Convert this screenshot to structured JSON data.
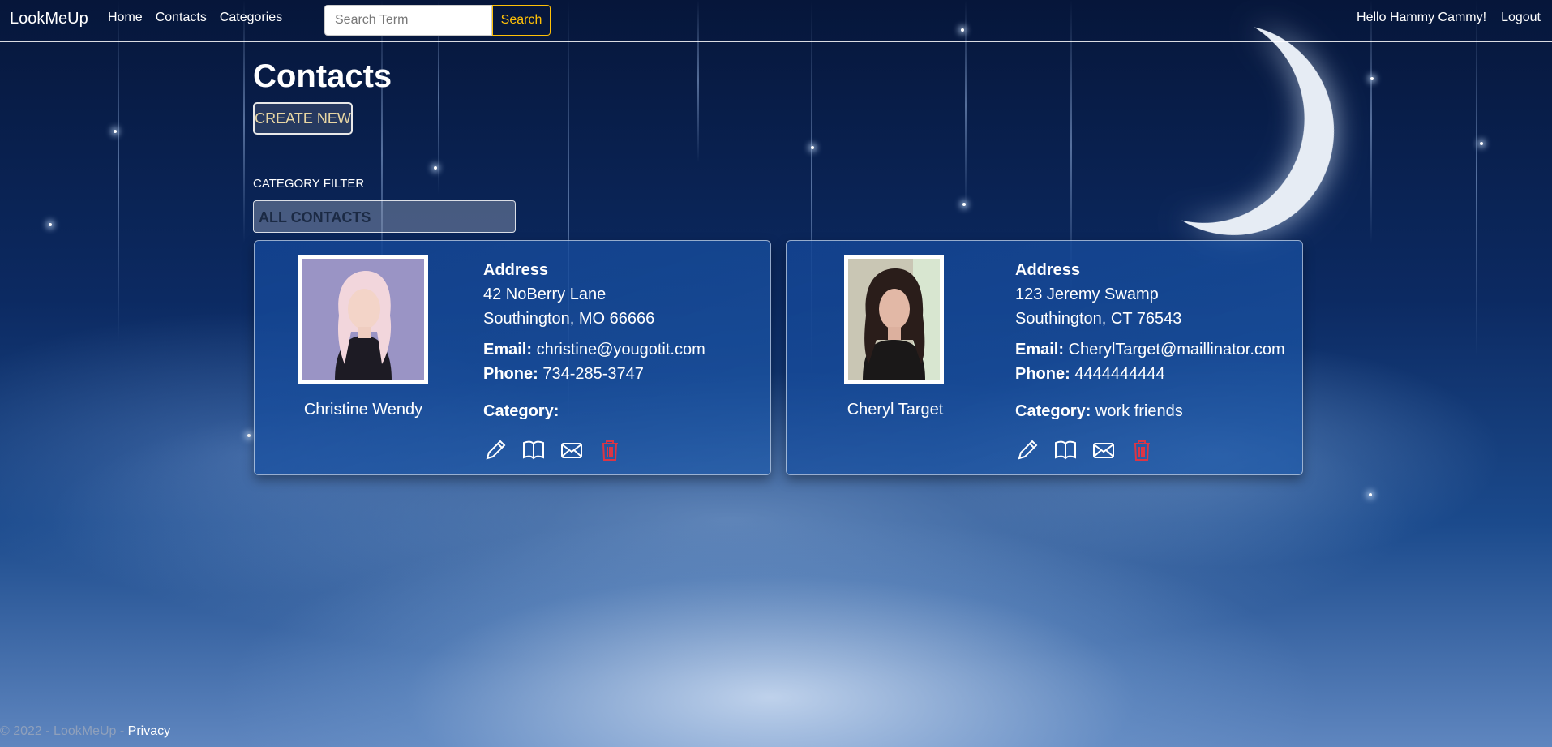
{
  "navbar": {
    "brand": "LookMeUp",
    "links": [
      "Home",
      "Contacts",
      "Categories"
    ],
    "search_placeholder": "Search Term",
    "search_button": "Search",
    "greeting": "Hello Hammy Cammy!",
    "logout": "Logout"
  },
  "main": {
    "title": "Contacts",
    "create_button": "CREATE NEW",
    "filter_label": "CATEGORY FILTER",
    "filter_selected": "ALL CONTACTS"
  },
  "contacts": [
    {
      "name": "Christine Wendy",
      "address_label": "Address",
      "address_line1": "42 NoBerry Lane",
      "address_line2": "Southington, MO 66666",
      "email_label": "Email:",
      "email": "christine@yougotit.com",
      "phone_label": "Phone:",
      "phone": "734-285-3747",
      "category_label": "Category:",
      "category": ""
    },
    {
      "name": "Cheryl Target",
      "address_label": "Address",
      "address_line1": "123 Jeremy Swamp",
      "address_line2": "Southington, CT 76543",
      "email_label": "Email:",
      "email": "CherylTarget@maillinator.com",
      "phone_label": "Phone:",
      "phone": "4444444444",
      "category_label": "Category:",
      "category": "work friends"
    }
  ],
  "action_icons": [
    "pencil-icon",
    "book-icon",
    "envelope-icon",
    "trash-icon"
  ],
  "footer": {
    "text": "© 2022 - LookMeUp - ",
    "privacy": "Privacy"
  },
  "colors": {
    "accent": "#ffc107",
    "delete": "#dc3545",
    "card_bg": "#1a4a92"
  }
}
